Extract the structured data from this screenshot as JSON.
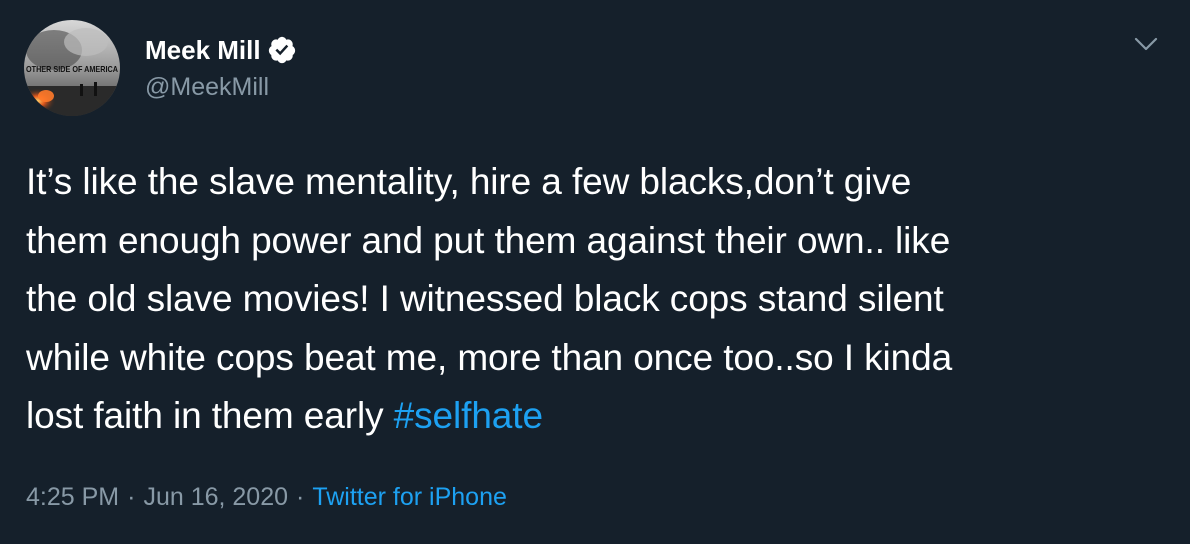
{
  "tweet": {
    "display_name": "Meek Mill",
    "handle": "@MeekMill",
    "avatar_text": "OTHER SIDE OF AMERICA",
    "verified_icon": "verified-badge-icon",
    "menu_icon": "chevron-down-icon",
    "text_lines": [
      "It’s like the slave mentality, hire a few blacks,don’t give",
      "them enough power and put them against their own.. like",
      "the old slave movies! I witnessed black cops stand silent",
      "while white cops beat me, more than once too..so I kinda",
      "lost faith in them early "
    ],
    "hashtag": "#selfhate",
    "time": "4:25 PM",
    "separator": "·",
    "date": "Jun 16, 2020",
    "source": "Twitter for iPhone"
  },
  "colors": {
    "background": "#15202b",
    "text": "#ffffff",
    "secondary": "#8899a6",
    "accent": "#1da1f2"
  }
}
